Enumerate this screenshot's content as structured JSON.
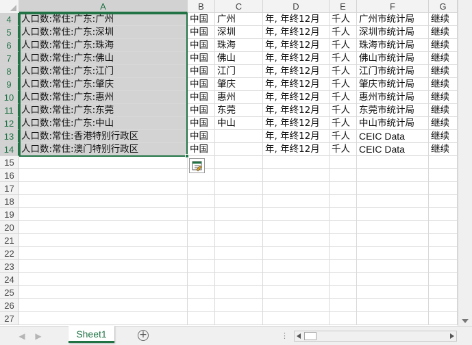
{
  "columns": [
    "A",
    "B",
    "C",
    "D",
    "E",
    "F",
    "G"
  ],
  "rows": [
    "4",
    "5",
    "6",
    "7",
    "8",
    "9",
    "10",
    "11",
    "12",
    "13",
    "14",
    "15",
    "16",
    "17",
    "18",
    "19",
    "20",
    "21",
    "22",
    "23",
    "24",
    "25",
    "26",
    "27"
  ],
  "cells": [
    [
      "人口数:常住:广东:广州",
      "中国",
      "广州",
      "年, 年终12月",
      "千人",
      "广州市统计局",
      "继续"
    ],
    [
      "人口数:常住:广东:深圳",
      "中国",
      "深圳",
      "年, 年终12月",
      "千人",
      "深圳市统计局",
      "继续"
    ],
    [
      "人口数:常住:广东:珠海",
      "中国",
      "珠海",
      "年, 年终12月",
      "千人",
      "珠海市统计局",
      "继续"
    ],
    [
      "人口数:常住:广东:佛山",
      "中国",
      "佛山",
      "年, 年终12月",
      "千人",
      "佛山市统计局",
      "继续"
    ],
    [
      "人口数:常住:广东:江门",
      "中国",
      "江门",
      "年, 年终12月",
      "千人",
      "江门市统计局",
      "继续"
    ],
    [
      "人口数:常住:广东:肇庆",
      "中国",
      "肇庆",
      "年, 年终12月",
      "千人",
      "肇庆市统计局",
      "继续"
    ],
    [
      "人口数:常住:广东:惠州",
      "中国",
      "惠州",
      "年, 年终12月",
      "千人",
      "惠州市统计局",
      "继续"
    ],
    [
      "人口数:常住:广东:东莞",
      "中国",
      "东莞",
      "年, 年终12月",
      "千人",
      "东莞市统计局",
      "继续"
    ],
    [
      "人口数:常住:广东:中山",
      "中国",
      "中山",
      "年, 年终12月",
      "千人",
      "中山市统计局",
      "继续"
    ],
    [
      "人口数:常住:香港特别行政区",
      "中国",
      "",
      "年, 年终12月",
      "千人",
      "CEIC Data",
      "继续"
    ],
    [
      "人口数:常住:澳门特别行政区",
      "中国",
      "",
      "年, 年终12月",
      "千人",
      "CEIC Data",
      "继续"
    ]
  ],
  "selected_column": "A",
  "selected_rows": [
    "4",
    "5",
    "6",
    "7",
    "8",
    "9",
    "10",
    "11",
    "12",
    "13",
    "14"
  ],
  "sheet_tab": "Sheet1",
  "add_sheet_symbol": "+",
  "nav_prev_symbol": "◀",
  "nav_next_symbol": "▶",
  "more_symbol": "⋮",
  "icons": [
    "quick-analysis-icon",
    "add-sheet-icon",
    "scroll-left-arrow-icon",
    "scroll-right-arrow-icon",
    "scroll-down-arrow-icon"
  ],
  "colors": {
    "accent": "#217346",
    "selection_fill": "#d3d3d3",
    "header_fill": "#f3f3f3",
    "gridline": "#d9d9d9"
  }
}
